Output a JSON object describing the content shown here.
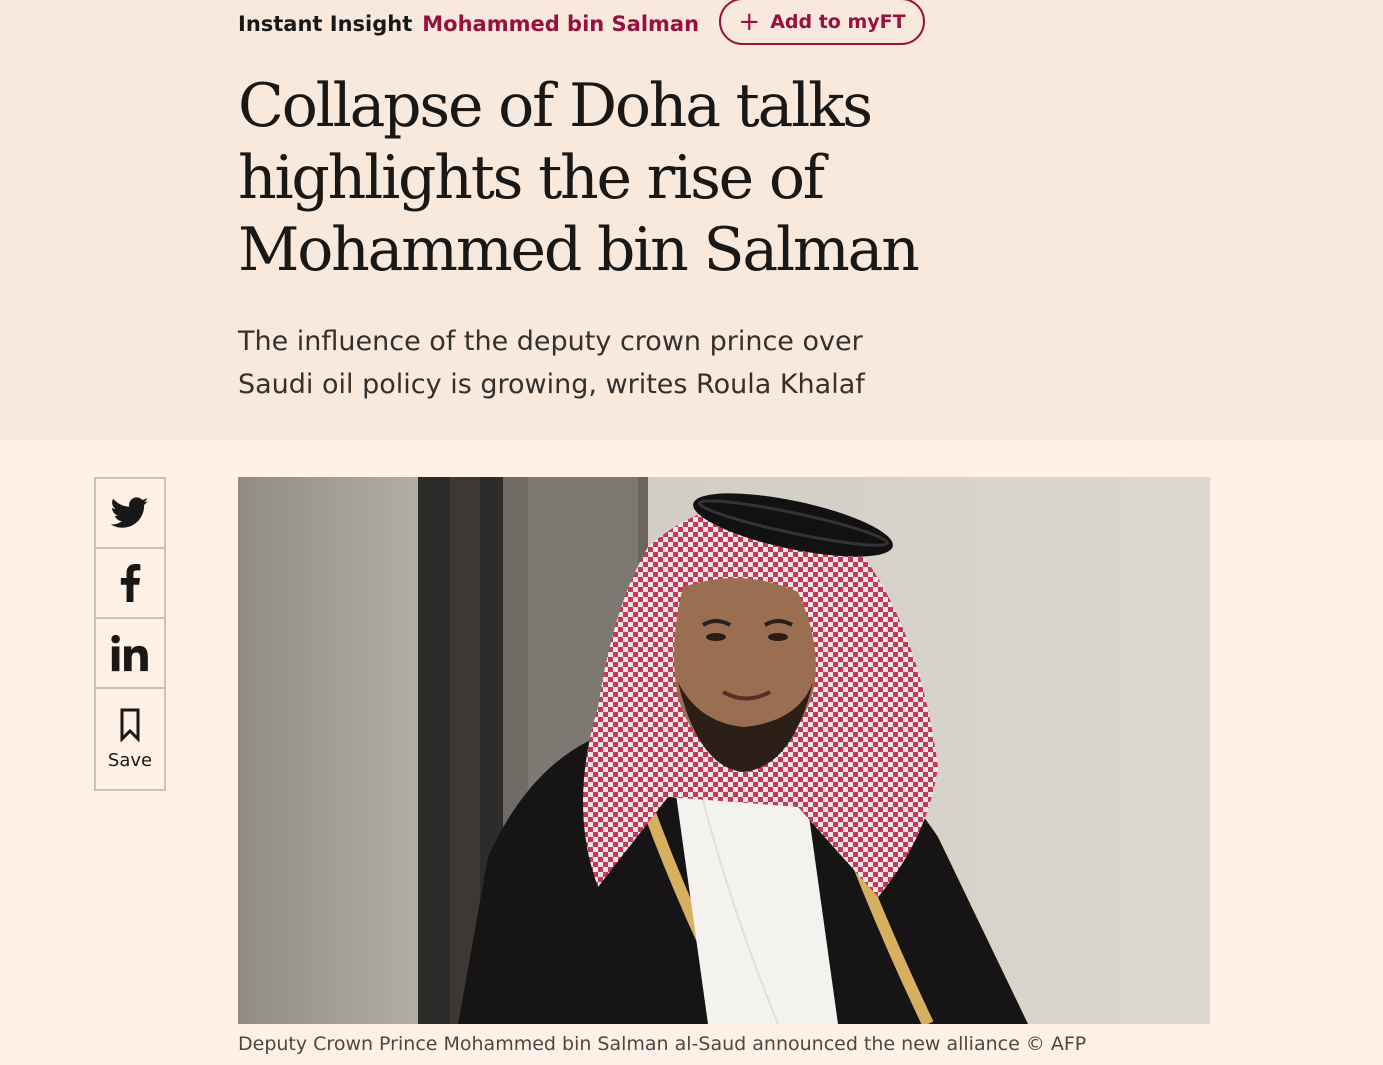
{
  "topic": {
    "prefix": "Instant Insight",
    "name": "Mohammed bin Salman",
    "follow_label": "Add to myFT",
    "follow_icon": "plus-icon"
  },
  "article": {
    "headline": "Collapse of Doha talks highlights the rise of Mohammed bin Salman",
    "standfirst": "The influence of the deputy crown prince over Saudi oil policy is growing, writes Roula Khalaf"
  },
  "share": {
    "items": [
      {
        "icon": "twitter-icon"
      },
      {
        "icon": "facebook-icon"
      },
      {
        "icon": "linkedin-icon"
      }
    ],
    "save_label": "Save",
    "save_icon": "bookmark-icon"
  },
  "image": {
    "caption": "Deputy Crown Prince Mohammed bin Salman al-Saud announced the new alliance © AFP"
  },
  "colors": {
    "header_background": "#f9e9dc",
    "page_background": "#fff1e5",
    "accent": "#990f3d",
    "text": "#1a1817"
  }
}
